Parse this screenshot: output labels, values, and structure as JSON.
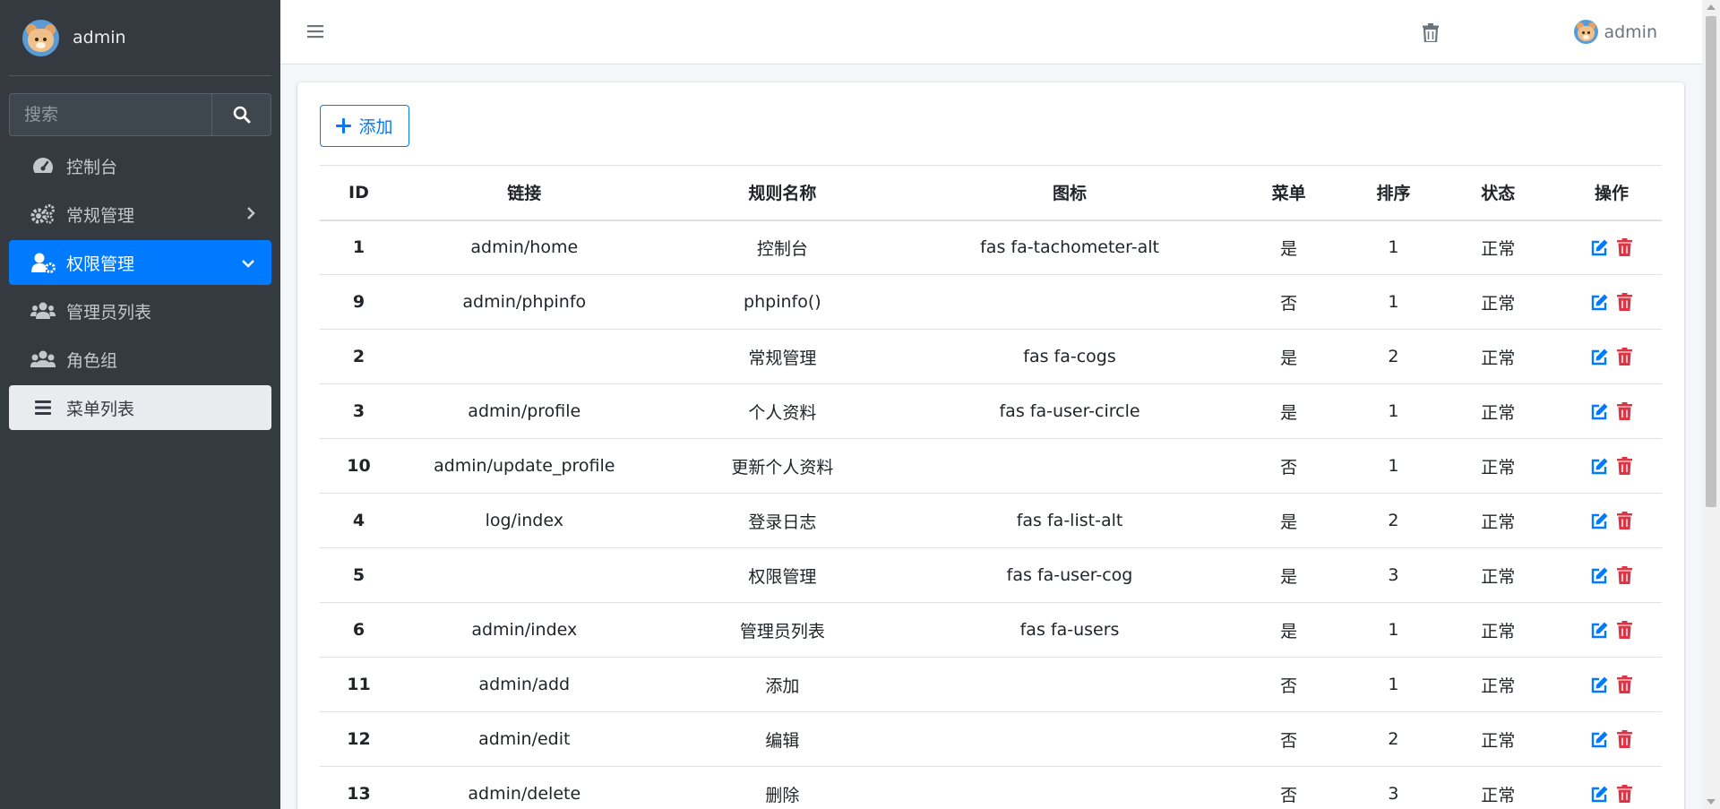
{
  "sidebar": {
    "user_name": "admin",
    "search_placeholder": "搜索",
    "items": [
      {
        "label": "控制台",
        "icon": "tachometer-icon"
      },
      {
        "label": "常规管理",
        "icon": "cogs-icon"
      },
      {
        "label": "权限管理",
        "icon": "user-cog-icon"
      },
      {
        "label": "管理员列表",
        "icon": "users-icon"
      },
      {
        "label": "角色组",
        "icon": "users-group-icon"
      },
      {
        "label": "菜单列表",
        "icon": "bars-icon"
      }
    ]
  },
  "header": {
    "user_name": "admin"
  },
  "toolbar": {
    "add_label": "添加"
  },
  "table": {
    "columns": [
      "ID",
      "链接",
      "规则名称",
      "图标",
      "菜单",
      "排序",
      "状态",
      "操作"
    ],
    "rows": [
      {
        "id": "1",
        "link": "admin/home",
        "name": "控制台",
        "icon": "fas fa-tachometer-alt",
        "menu": "是",
        "sort": "1",
        "status": "正常"
      },
      {
        "id": "9",
        "link": "admin/phpinfo",
        "name": "phpinfo()",
        "icon": "",
        "menu": "否",
        "sort": "1",
        "status": "正常"
      },
      {
        "id": "2",
        "link": "",
        "name": "常规管理",
        "icon": "fas fa-cogs",
        "menu": "是",
        "sort": "2",
        "status": "正常"
      },
      {
        "id": "3",
        "link": "admin/profile",
        "name": "个人资料",
        "icon": "fas fa-user-circle",
        "menu": "是",
        "sort": "1",
        "status": "正常"
      },
      {
        "id": "10",
        "link": "admin/update_profile",
        "name": "更新个人资料",
        "icon": "",
        "menu": "否",
        "sort": "1",
        "status": "正常"
      },
      {
        "id": "4",
        "link": "log/index",
        "name": "登录日志",
        "icon": "fas fa-list-alt",
        "menu": "是",
        "sort": "2",
        "status": "正常"
      },
      {
        "id": "5",
        "link": "",
        "name": "权限管理",
        "icon": "fas fa-user-cog",
        "menu": "是",
        "sort": "3",
        "status": "正常"
      },
      {
        "id": "6",
        "link": "admin/index",
        "name": "管理员列表",
        "icon": "fas fa-users",
        "menu": "是",
        "sort": "1",
        "status": "正常"
      },
      {
        "id": "11",
        "link": "admin/add",
        "name": "添加",
        "icon": "",
        "menu": "否",
        "sort": "1",
        "status": "正常"
      },
      {
        "id": "12",
        "link": "admin/edit",
        "name": "编辑",
        "icon": "",
        "menu": "否",
        "sort": "2",
        "status": "正常"
      },
      {
        "id": "13",
        "link": "admin/delete",
        "name": "删除",
        "icon": "",
        "menu": "否",
        "sort": "3",
        "status": "正常"
      }
    ]
  },
  "colors": {
    "sidebar_bg": "#343a40",
    "primary": "#007bff",
    "danger": "#dc3545"
  }
}
